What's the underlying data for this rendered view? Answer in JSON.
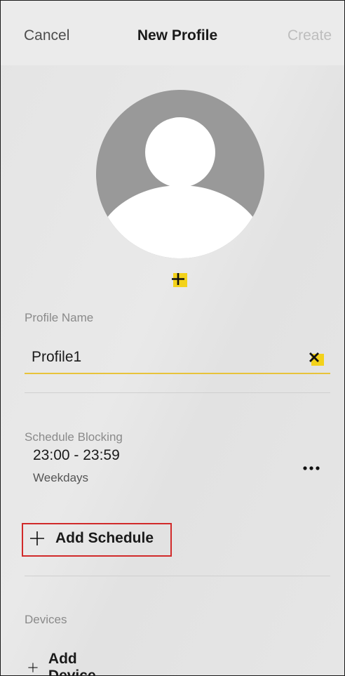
{
  "header": {
    "cancel_label": "Cancel",
    "title": "New Profile",
    "create_label": "Create"
  },
  "avatar": {
    "icon": "user-avatar-placeholder"
  },
  "profile_name": {
    "label": "Profile Name",
    "value": "Profile1"
  },
  "schedule": {
    "section_label": "Schedule Blocking",
    "items": [
      {
        "time": "23:00 - 23:59",
        "days": "Weekdays"
      }
    ],
    "add_label": "Add Schedule"
  },
  "devices": {
    "section_label": "Devices",
    "add_label": "Add Device"
  },
  "colors": {
    "highlight": "#f3d21a",
    "input_underline": "#e8c33a",
    "callout_border": "#d12a2a"
  }
}
